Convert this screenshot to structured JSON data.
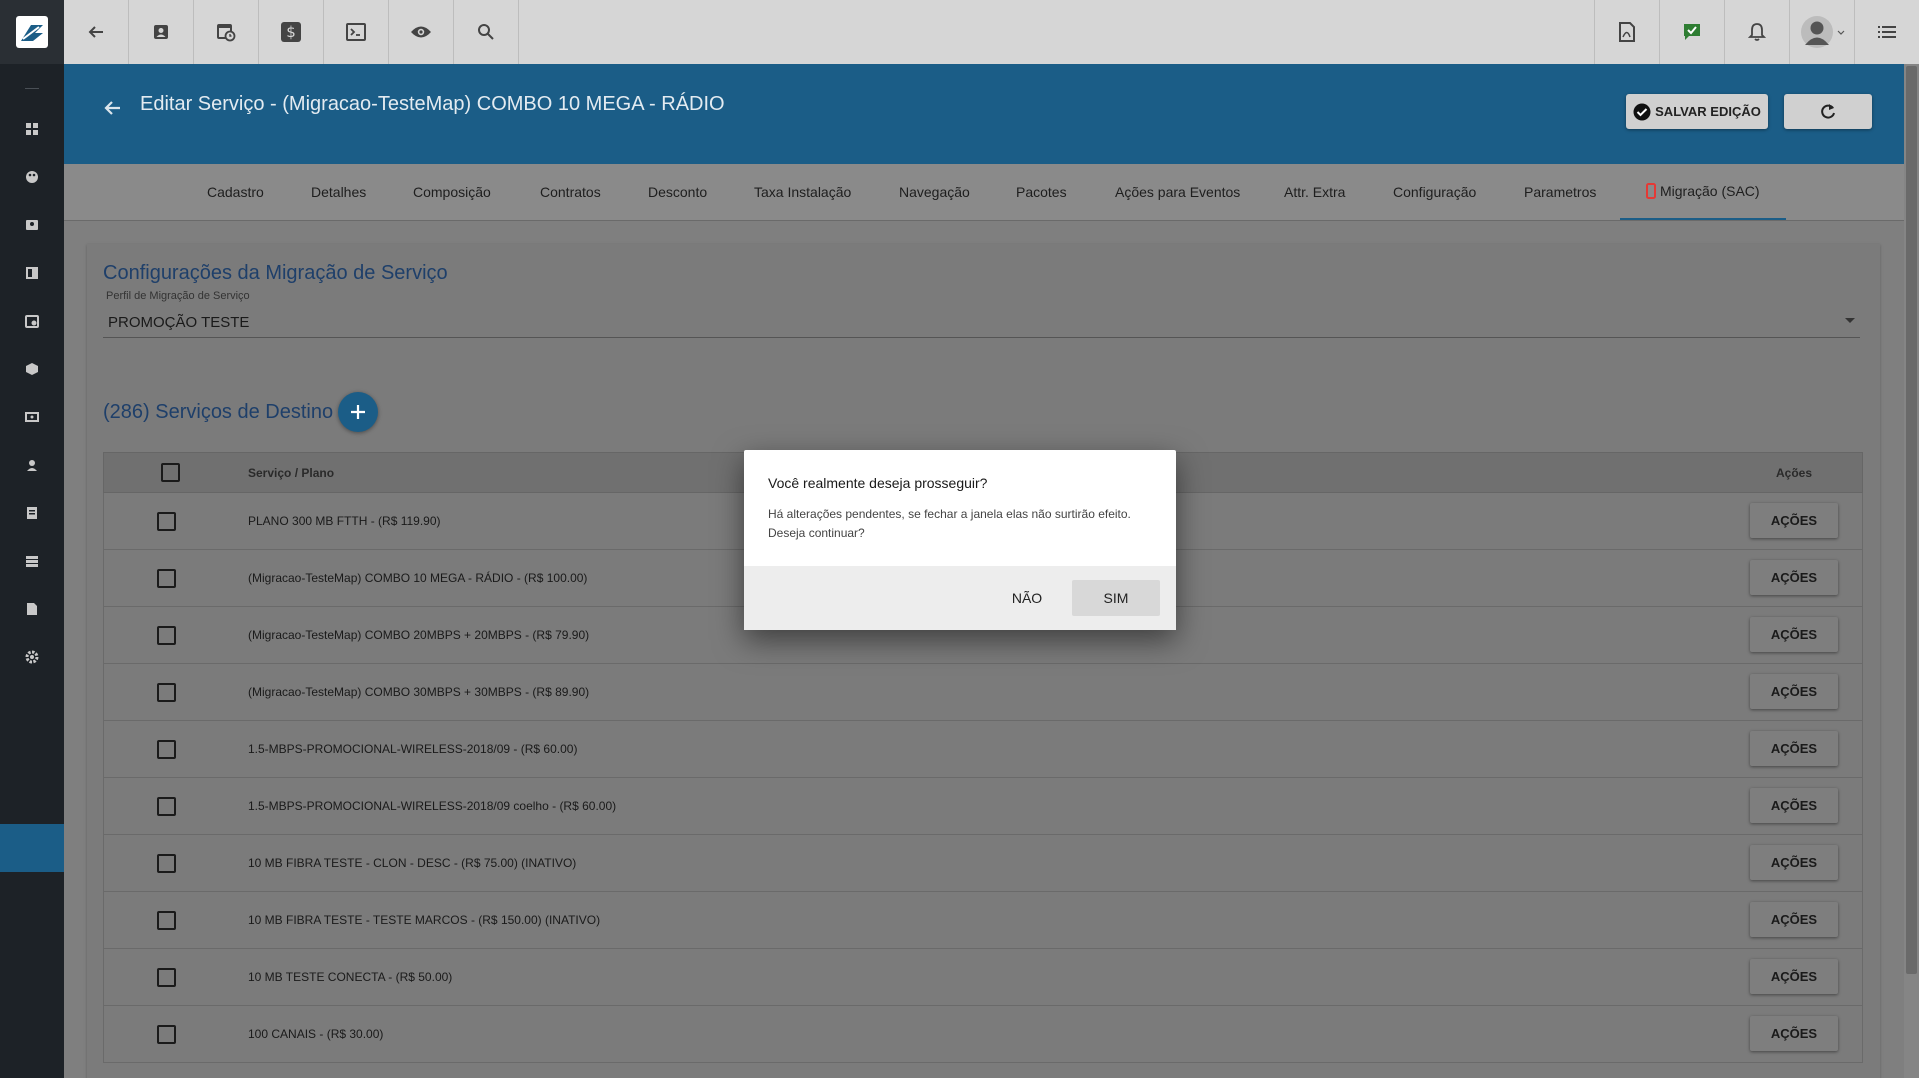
{
  "topbar": {
    "left_icons": [
      "back-arrow-icon",
      "contact-card-icon",
      "calendar-clock-icon",
      "dollar-icon",
      "terminal-icon",
      "eye-icon",
      "search-icon"
    ],
    "right_icons": [
      "pdf-icon",
      "chat-check-icon",
      "bell-icon",
      "user-avatar",
      "list-menu-icon"
    ]
  },
  "sidebar": {
    "icons": [
      "dashboard-icon",
      "palette-icon",
      "contact-icon",
      "board-icon",
      "calendar-icon",
      "box-icon",
      "money-icon",
      "person-pin-icon",
      "document-icon",
      "server-icon",
      "file-icon",
      "gear-icon"
    ]
  },
  "header": {
    "title": "Editar Serviço - (Migracao-TesteMap) COMBO 10 MEGA - RÁDIO",
    "save_label": "SALVAR EDIÇÃO"
  },
  "tabs": [
    "Cadastro",
    "Detalhes",
    "Composição",
    "Contratos",
    "Desconto",
    "Taxa Instalação",
    "Navegação",
    "Pacotes",
    "Ações para Eventos",
    "Attr. Extra",
    "Configuração",
    "Parametros"
  ],
  "active_tab": "Migração (SAC)",
  "config": {
    "title": "Configurações da Migração de Serviço",
    "perfil_label": "Perfil de Migração de Serviço",
    "perfil_value": "PROMOÇÃO TESTE"
  },
  "destinos": {
    "title": "(286) Serviços de Destino",
    "col_servico": "Serviço / Plano",
    "col_acoes": "Ações",
    "action_label": "AÇÕES",
    "rows": [
      "PLANO 300 MB FTTH - (R$ 119.90)",
      "(Migracao-TesteMap) COMBO 10 MEGA - RÁDIO - (R$ 100.00)",
      "(Migracao-TesteMap) COMBO 20MBPS + 20MBPS - (R$ 79.90)",
      "(Migracao-TesteMap) COMBO 30MBPS + 30MBPS - (R$ 89.90)",
      "1.5-MBPS-PROMOCIONAL-WIRELESS-2018/09 - (R$ 60.00)",
      "1.5-MBPS-PROMOCIONAL-WIRELESS-2018/09 coelho - (R$ 60.00)",
      "10 MB FIBRA TESTE - CLON - DESC - (R$ 75.00) (INATIVO)",
      "10 MB FIBRA TESTE - TESTE MARCOS - (R$ 150.00) (INATIVO)",
      "10 MB TESTE CONECTA - (R$ 50.00)",
      "100 CANAIS - (R$ 30.00)"
    ]
  },
  "dialog": {
    "title": "Você realmente deseja prosseguir?",
    "message": "Há alterações pendentes, se fechar a janela elas não surtirão efeito. Deseja continuar?",
    "no_label": "NÃO",
    "yes_label": "SIM"
  },
  "colors": {
    "header_blue": "#1b5d87",
    "sidebar_dark": "#1d2227",
    "chat_green": "#2e7d32",
    "mobile_red": "#e53935"
  }
}
